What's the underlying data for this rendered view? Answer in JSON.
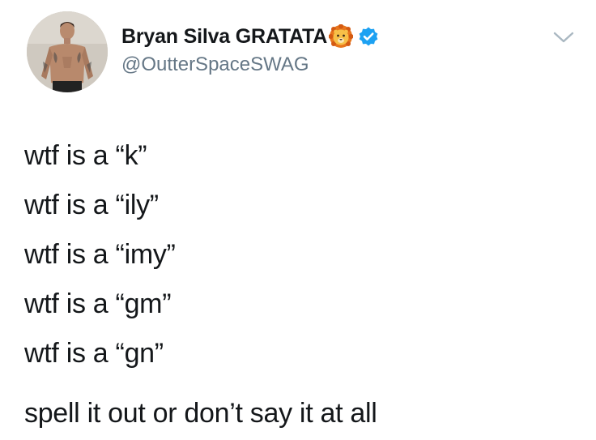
{
  "author": {
    "display_name": "Bryan Silva GRATATA",
    "handle": "@OutterSpaceSWAG",
    "emoji_icon": "lion-face-emoji-icon",
    "verified_icon": "verified-badge-icon",
    "avatar": "profile-photo"
  },
  "menu_icon": "chevron-down-icon",
  "tweet": {
    "lines": [
      "wtf is a “k”",
      "wtf is a “ily”",
      "wtf is a “imy”",
      "wtf is a “gm”",
      "wtf is a “gn”",
      "spell it out or don’t say it at all"
    ]
  },
  "colors": {
    "text": "#14171a",
    "secondary_text": "#657786",
    "verified_blue": "#1da1f2",
    "chevron": "#aab8c2"
  }
}
